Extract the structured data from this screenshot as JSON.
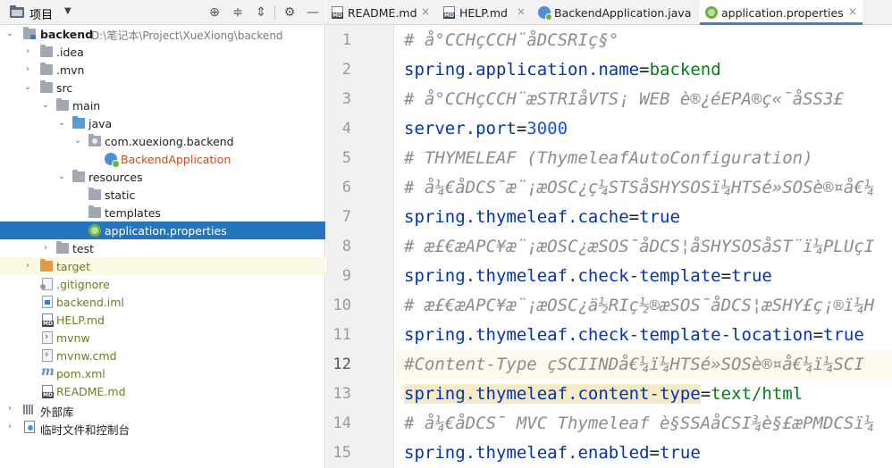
{
  "project_panel": {
    "title": "项目",
    "dropdown": "▼",
    "toolbar_icons": [
      "locate-icon",
      "collapse-all-icon",
      "expand-all-icon",
      "settings-icon",
      "hide-icon"
    ]
  },
  "tree": [
    {
      "label": "backend",
      "path": "D:\\笔记本\\Project\\XueXiong\\backend"
    },
    {
      "label": ".idea"
    },
    {
      "label": ".mvn"
    },
    {
      "label": "src"
    },
    {
      "label": "main"
    },
    {
      "label": "java"
    },
    {
      "label": "com.xuexiong.backend"
    },
    {
      "label": "BackendApplication"
    },
    {
      "label": "resources"
    },
    {
      "label": "static"
    },
    {
      "label": "templates"
    },
    {
      "label": "application.properties"
    },
    {
      "label": "test"
    },
    {
      "label": "target"
    },
    {
      "label": ".gitignore"
    },
    {
      "label": "backend.iml"
    },
    {
      "label": "HELP.md"
    },
    {
      "label": "mvnw"
    },
    {
      "label": "mvnw.cmd"
    },
    {
      "label": "pom.xml"
    },
    {
      "label": "README.md"
    },
    {
      "label": "外部库"
    },
    {
      "label": "临时文件和控制台"
    }
  ],
  "tabs": [
    {
      "label": "README.md",
      "icon": "markdown-icon",
      "active": false
    },
    {
      "label": "HELP.md",
      "icon": "markdown-icon",
      "active": false
    },
    {
      "label": "BackendApplication.java",
      "icon": "spring-class-icon",
      "active": false
    },
    {
      "label": "application.properties",
      "icon": "spring-properties-icon",
      "active": true
    }
  ],
  "close_glyph": "×",
  "line_numbers": [
    "1",
    "2",
    "3",
    "4",
    "5",
    "6",
    "7",
    "8",
    "9",
    "10",
    "11",
    "12",
    "13",
    "14",
    "15"
  ],
  "code": {
    "l1": {
      "comment": "# å°CCHçCCH¨åDCSRIç§°"
    },
    "l2": {
      "key": "spring.application.name",
      "eq": "=",
      "value": "backend"
    },
    "l3": {
      "comment": "# å°CCHçCCH¨æSTRIåVTS¡ WEB è®¿éEPA®ç«¯åSS3£"
    },
    "l4": {
      "key": "server.port",
      "eq": "=",
      "value": "3000"
    },
    "l5": {
      "comment": "# THYMELEAF (ThymeleafAutoConfiguration)"
    },
    "l6": {
      "comment": "# å¼€åDCS¯æ¨¡æOSC¿ç¼STSåSHYSOSï¼HTSé»SOSè®¤å€¼"
    },
    "l7": {
      "key": "spring.thymeleaf.cache",
      "eq": "=",
      "value": "true"
    },
    "l8": {
      "comment": "# æ£€æAPC¥æ¨¡æOSC¿æSOS¯åDCS¦åSHYSOSåST¨ï¼PLUçI"
    },
    "l9": {
      "key": "spring.thymeleaf.check-template",
      "eq": "=",
      "value": "true"
    },
    "l10": {
      "comment": "# æ£€æAPC¥æ¨¡æOSC¿ä½RIç½®æSOS¯åDCS¦æSHY£ç¡®ï¼H"
    },
    "l11": {
      "key": "spring.thymeleaf.check-template-location",
      "eq": "=",
      "value": "true"
    },
    "l12": {
      "comment": "#Content-Type çSCIINDå€¼ï¼HTSé»SOSè®¤å€¼ï¼SCI"
    },
    "l13": {
      "key": "spring.thymeleaf.content-type",
      "eq": "=",
      "value": "text/html"
    },
    "l14": {
      "comment": "# å¼€åDCS¯ MVC Thymeleaf è§SSAåCSI¾è§£æPMDCSï¼"
    },
    "l15": {
      "key": "spring.thymeleaf.enabled",
      "eq": "=",
      "value": "true"
    }
  }
}
